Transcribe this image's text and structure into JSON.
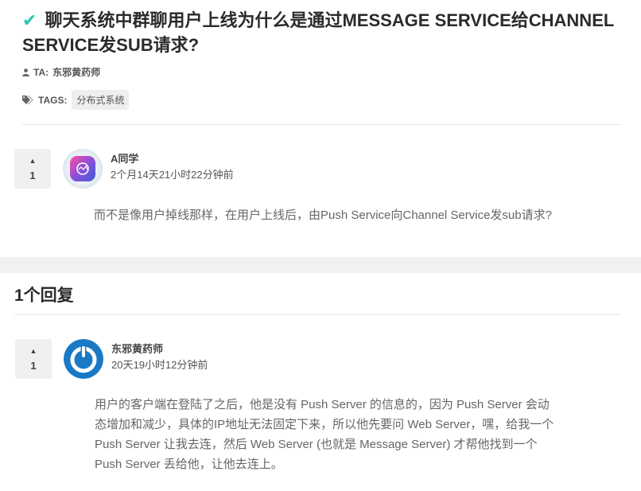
{
  "question": {
    "title": "聊天系统中群聊用户上线为什么是通过MESSAGE SERVICE给CHANNEL SERVICE发SUB请求?",
    "ta_label": "TA:",
    "ta_name": "东邪黄药师",
    "tags_label": "TAGS:",
    "tags": [
      "分布式系统"
    ],
    "votes": "1",
    "author": "A同学",
    "time": "2个月14天21小时22分钟前",
    "body": "而不是像用户掉线那样，在用户上线后，由Push Service向Channel Service发sub请求?"
  },
  "replies_heading": "1个回复",
  "reply": {
    "votes": "1",
    "author": "东邪黄药师",
    "time": "20天19小时12分钟前",
    "lines": [
      "用户的客户端在登陆了之后，他是没有 Push Server 的信息的，因为 Push Server 会动",
      "态增加和减少，具体的IP地址无法固定下来，所以他先要问 Web Server，嘿，给我一个",
      "Push Server 让我去连，然后 Web Server (也就是 Message Server) 才帮他找到一个",
      "Push Server 丢给他，让他去连上。"
    ]
  },
  "colors": {
    "check": "#2bc3b1",
    "reply_avatar": "#1b79c4"
  },
  "icons": {
    "check": "check-icon",
    "user": "user-icon",
    "tags": "tags-icon",
    "upvote": "upvote-arrow-icon"
  }
}
